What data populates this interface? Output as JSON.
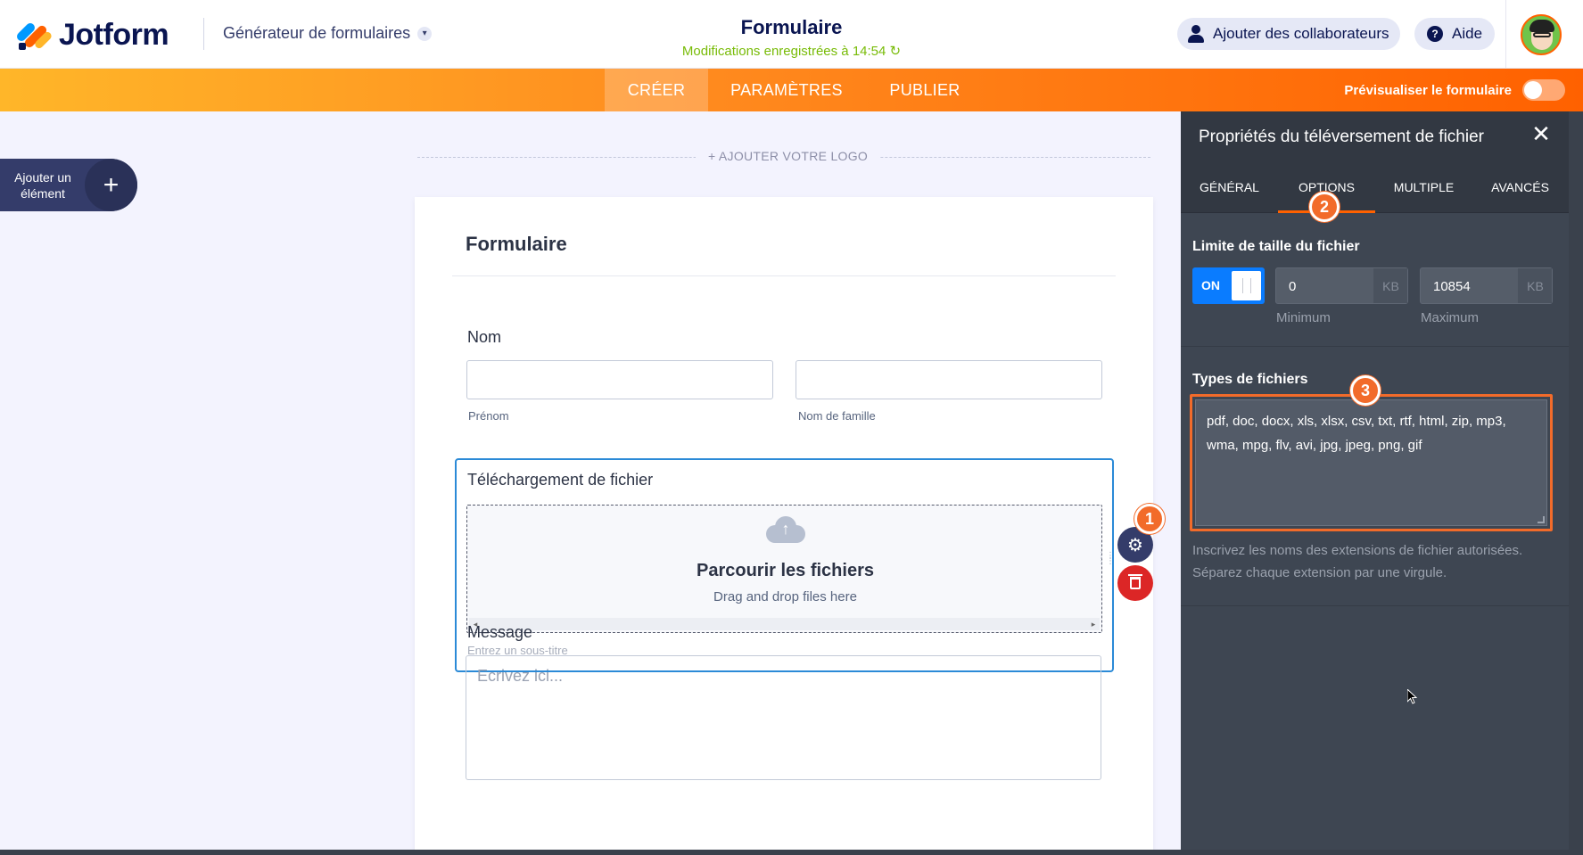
{
  "header": {
    "logo_text": "Jotform",
    "builder_menu": "Générateur de formulaires",
    "form_title": "Formulaire",
    "saved_status": "Modifications enregistrées à 14:54",
    "collaborators_button": "Ajouter des collaborateurs",
    "help_button": "Aide",
    "help_icon_glyph": "?"
  },
  "nav": {
    "tabs": [
      "CRÉER",
      "PARAMÈTRES",
      "PUBLIER"
    ],
    "active_tab": "CRÉER",
    "preview_label": "Prévisualiser le formulaire",
    "preview_enabled": false
  },
  "left": {
    "add_element_label": "Ajouter un élément",
    "add_logo_label": "+ AJOUTER VOTRE LOGO"
  },
  "form": {
    "title": "Formulaire",
    "name_field": {
      "label": "Nom",
      "first_sublabel": "Prénom",
      "last_sublabel": "Nom de famille"
    },
    "upload_field": {
      "label": "Téléchargement de fichier",
      "browse": "Parcourir les fichiers",
      "drag_drop": "Drag and drop files here",
      "subtitle_placeholder": "Entrez un sous-titre"
    },
    "message_field": {
      "label": "Message",
      "placeholder": "Ecrivez ici..."
    }
  },
  "badges": [
    "1",
    "2",
    "3"
  ],
  "panel": {
    "title": "Propriétés du téléversement de fichier",
    "tabs": [
      "GÉNÉRAL",
      "OPTIONS",
      "MULTIPLE",
      "AVANCÉS"
    ],
    "active_tab": "OPTIONS",
    "size_limit": {
      "title": "Limite de taille du fichier",
      "toggle_label": "ON",
      "min_value": "0",
      "max_value": "10854",
      "unit": "KB",
      "min_caption": "Minimum",
      "max_caption": "Maximum"
    },
    "file_types": {
      "title": "Types de fichiers",
      "value": "pdf, doc, docx, xls, xlsx, csv, txt, rtf, html, zip, mp3, wma, mpg, flv, avi, jpg, jpeg, png, gif",
      "help": "Inscrivez les noms des extensions de fichier autorisées. Séparez chaque extension par une virgule."
    }
  },
  "colors": {
    "accent_orange": "#ff6100",
    "toggle_blue": "#0a7cff",
    "panel_bg": "#3e4652",
    "field_selected": "#2b8ad7",
    "delete_red": "#dc2626",
    "saved_green": "#78bb07"
  }
}
